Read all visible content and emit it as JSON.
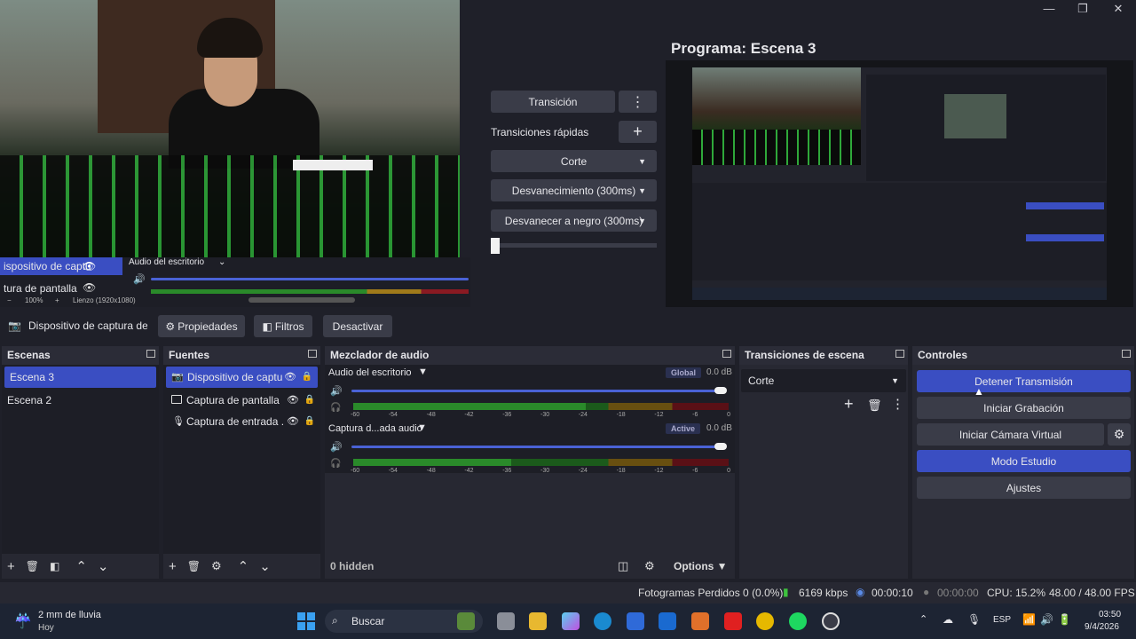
{
  "window": {
    "minimize": "—",
    "maximize": "❐",
    "close": "✕"
  },
  "program": {
    "title": "Programa: Escena 3"
  },
  "left_preview": {
    "source1": "ispositivo de captu",
    "source2": "tura de pantalla",
    "mixer_label": "Audio del escritorio",
    "zoom": "100%",
    "canvas": "Lienzo (1920x1080)"
  },
  "transitions_panel": {
    "transition_btn": "Transición",
    "quick_label": "Transiciones rápidas",
    "quick": [
      "Corte",
      "Desvanecimiento (300ms)",
      "Desvanecer a negro (300ms)"
    ]
  },
  "source_toolbar": {
    "source_name": "Dispositivo de captura de v",
    "properties": "Propiedades",
    "filters": "Filtros",
    "deactivate": "Desactivar"
  },
  "scenes": {
    "title": "Escenas",
    "items": [
      "Escena 3",
      "Escena 2"
    ]
  },
  "sources": {
    "title": "Fuentes",
    "items": [
      "Dispositivo de captu",
      "Captura de pantalla",
      "Captura de entrada ."
    ]
  },
  "mixer": {
    "title": "Mezclador de audio",
    "tracks": [
      {
        "name": "Audio del escritorio",
        "badge": "Global",
        "db": "0.0 dB",
        "level": 0.62
      },
      {
        "name": "Captura d...ada audio",
        "badge": "Active",
        "db": "0.0 dB",
        "level": 0.42
      }
    ],
    "ticks": [
      "-60",
      "-54",
      "-48",
      "-42",
      "-36",
      "-30",
      "-24",
      "-18",
      "-12",
      "-6",
      "0"
    ],
    "hidden": "0 hidden",
    "options": "Options"
  },
  "scene_transitions": {
    "title": "Transiciones de escena",
    "selected": "Corte"
  },
  "controls": {
    "title": "Controles",
    "stop_stream": "Detener Transmisión",
    "start_recording": "Iniciar Grabación",
    "virtual_cam": "Iniciar Cámara Virtual",
    "studio_mode": "Modo Estudio",
    "settings": "Ajustes"
  },
  "status": {
    "dropped": "Fotogramas Perdidos 0 (0.0%)",
    "kbps": "6169 kbps",
    "stream_time": "00:00:10",
    "rec_time": "00:00:00",
    "cpu": "CPU: 15.2%",
    "fps": "48.00 / 48.00 FPS"
  },
  "taskbar": {
    "weather": "2 mm de lluvia",
    "weather_sub": "Hoy",
    "search": "Buscar",
    "lang": "ESP",
    "time": "03:50",
    "date": "9/4/2026"
  },
  "colors": {
    "accent": "#3a4ec2",
    "bg": "#1f2029",
    "panel": "#272832"
  }
}
